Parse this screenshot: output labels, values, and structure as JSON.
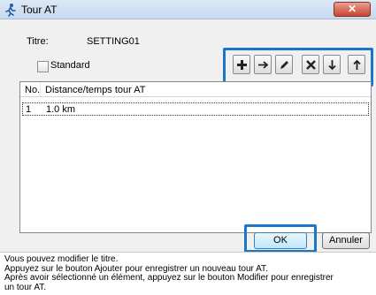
{
  "window": {
    "title": "Tour AT",
    "close_symbol": "✕"
  },
  "form": {
    "title_label": "Titre:",
    "title_value": "SETTING01",
    "standard_label": "Standard",
    "standard_checked": false
  },
  "toolbar": {
    "buttons": [
      {
        "name": "add",
        "icon": "plus-icon"
      },
      {
        "name": "move",
        "icon": "arrow-right-icon"
      },
      {
        "name": "edit",
        "icon": "pencil-icon"
      },
      {
        "name": "delete",
        "icon": "x-icon"
      },
      {
        "name": "move-down",
        "icon": "arrow-down-icon"
      },
      {
        "name": "move-up",
        "icon": "arrow-up-icon"
      }
    ]
  },
  "list": {
    "columns": [
      "No.",
      "Distance/temps tour AT"
    ],
    "rows": [
      {
        "no": "1",
        "distance": "1.0 km"
      }
    ]
  },
  "buttons": {
    "ok_label": "OK",
    "cancel_label": "Annuler"
  },
  "info": {
    "lines": [
      "Vous pouvez modifier le titre.",
      "Appuyez sur le bouton Ajouter pour enregistrer un nouveau tour AT.",
      "Après avoir sélectionné un élément, appuyez sur le bouton Modifier pour enregistrer",
      "un tour AT."
    ]
  },
  "colors": {
    "highlight": "#1976c8",
    "titlebar": "#c6d9ee",
    "close_button": "#c9442e"
  }
}
